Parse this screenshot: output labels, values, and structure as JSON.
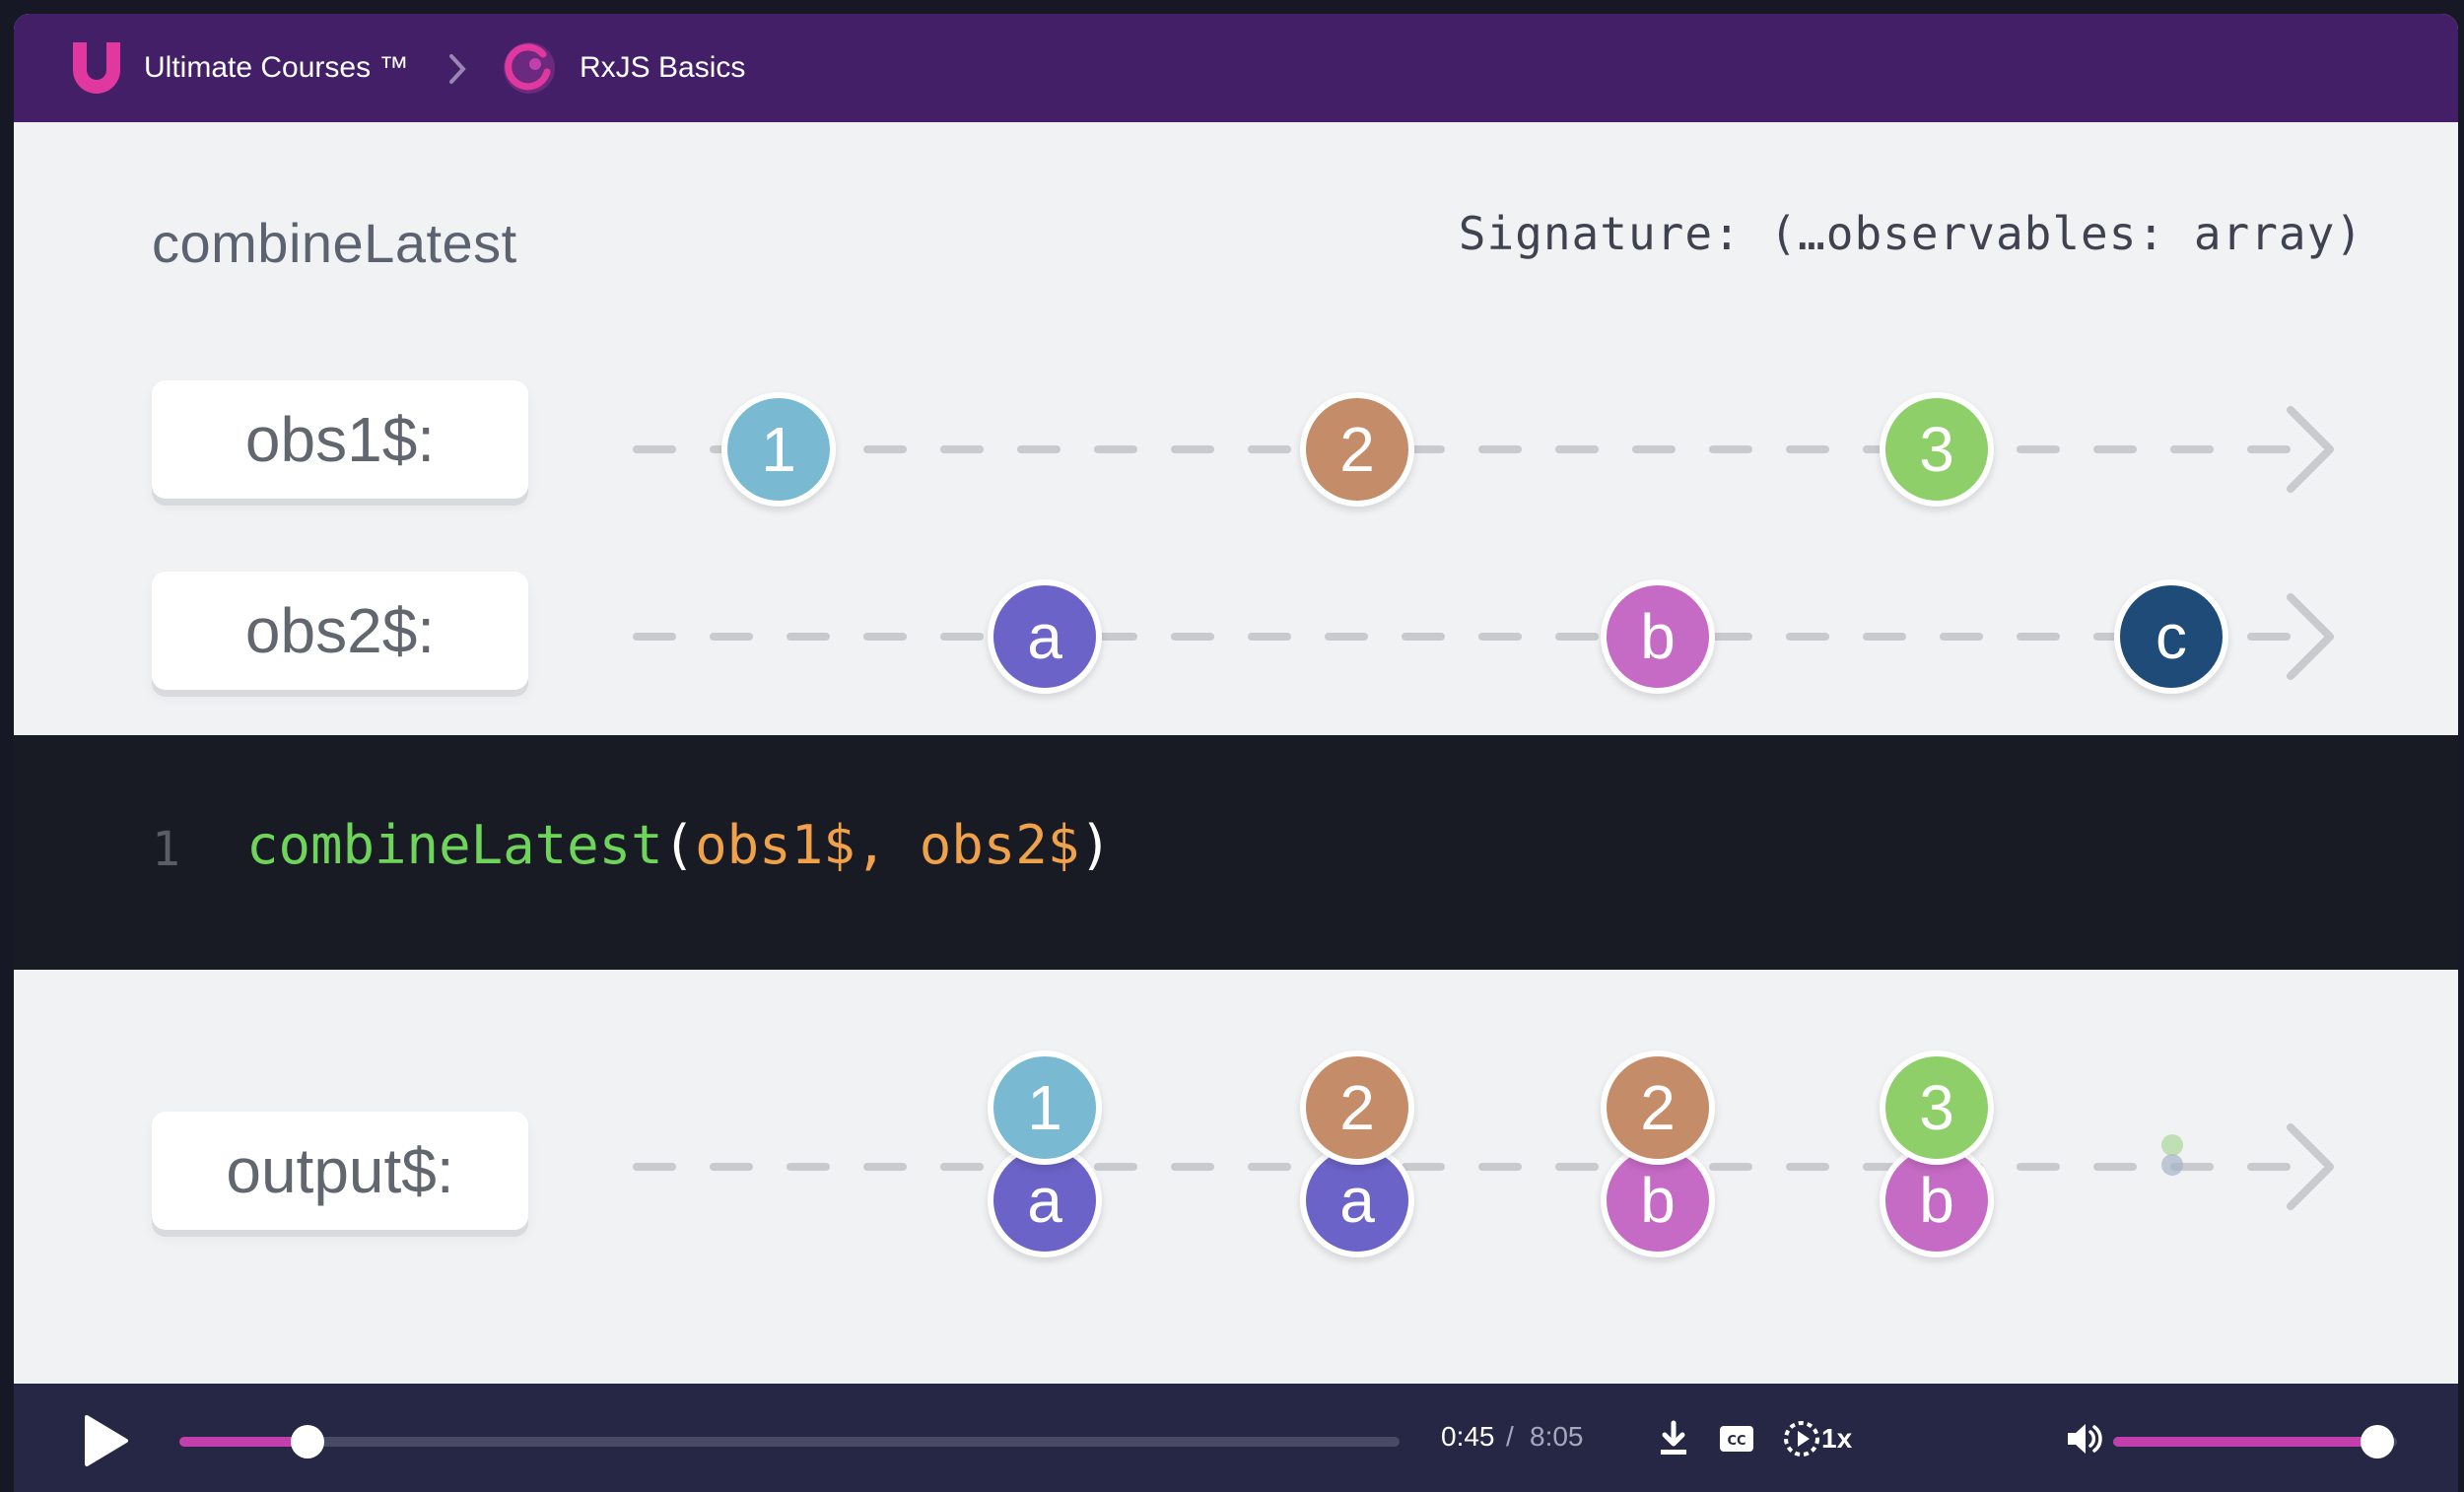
{
  "header": {
    "brand": "Ultimate Courses ™",
    "course": "RxJS Basics",
    "colors": {
      "bar": "#431f68",
      "logo": "#e0389e"
    }
  },
  "diagram": {
    "operator": "combineLatest",
    "signature": "Signature: (…observables: array)",
    "streams": [
      {
        "label": "obs1$:",
        "marbles": [
          {
            "value": "1",
            "color": "#79b9d1"
          },
          {
            "value": "2",
            "color": "#c48c68"
          },
          {
            "value": "3",
            "color": "#8fcf69"
          }
        ]
      },
      {
        "label": "obs2$:",
        "marbles": [
          {
            "value": "a",
            "color": "#6b63c7"
          },
          {
            "value": "b",
            "color": "#c56ac5"
          },
          {
            "value": "c",
            "color": "#1f4b78"
          }
        ]
      }
    ]
  },
  "code": {
    "line_number": "1",
    "function": "combineLatest",
    "open_paren": "(",
    "arg1": "obs1$",
    "comma": ", ",
    "arg2": "obs2$",
    "close_paren": ")"
  },
  "output": {
    "label": "output$:",
    "pairs": [
      {
        "top": "1",
        "bottom": "a"
      },
      {
        "top": "2",
        "bottom": "a"
      },
      {
        "top": "2",
        "bottom": "b"
      },
      {
        "top": "3",
        "bottom": "b"
      }
    ]
  },
  "player": {
    "current_time": "0:45",
    "separator": "/",
    "total_time": "8:05",
    "speed": "1x",
    "progress": 0.105,
    "volume": 0.93,
    "accent": "#c33fad",
    "icons": [
      "play-icon",
      "download-icon",
      "captions-icon",
      "playback-speed-icon",
      "volume-icon"
    ]
  }
}
